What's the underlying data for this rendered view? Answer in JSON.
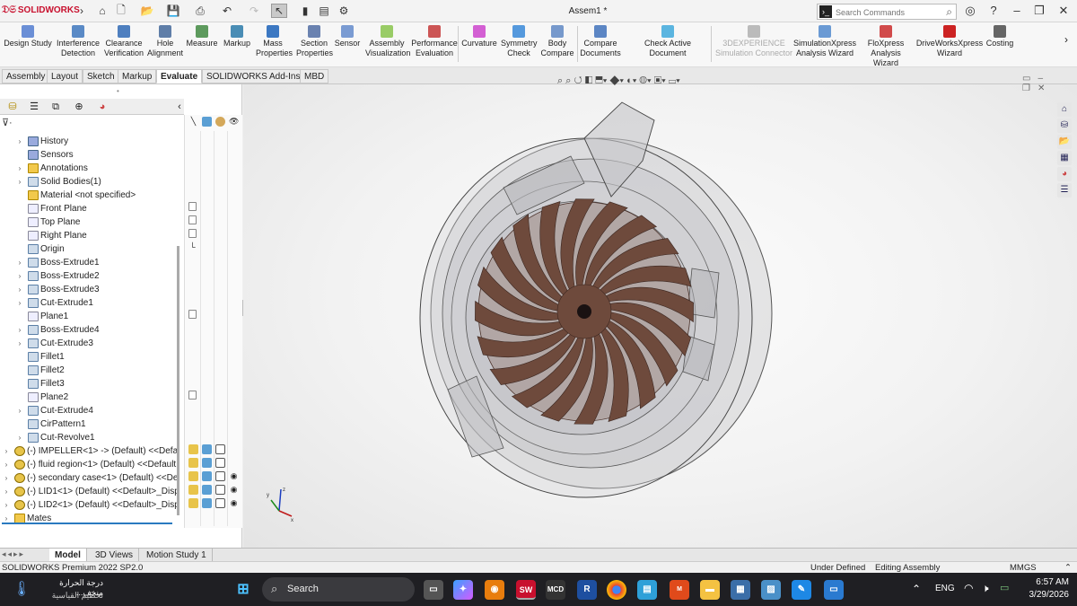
{
  "app": {
    "brand": "SOLIDWORKS",
    "doc_title": "Assem1 *"
  },
  "search": {
    "placeholder": "Search Commands"
  },
  "ribbon": [
    {
      "label": "Design Study",
      "color": "#6b8fd6"
    },
    {
      "label": "Interference Detection",
      "color": "#5a8ac6"
    },
    {
      "label": "Clearance Verification",
      "color": "#4e7fbf"
    },
    {
      "label": "Hole Alignment",
      "color": "#5f7ea8"
    },
    {
      "label": "Measure",
      "color": "#5d9a5d"
    },
    {
      "label": "Markup",
      "color": "#4a8db5"
    },
    {
      "label": "Mass Properties",
      "color": "#3c78c2"
    },
    {
      "label": "Section Properties",
      "color": "#6a82b0"
    },
    {
      "label": "Sensor",
      "color": "#7a9bd2"
    },
    {
      "label": "Assembly Visualization",
      "color": "#9c6"
    },
    {
      "label": "Performance Evaluation",
      "color": "#c55"
    },
    {
      "label": "Curvature",
      "color": "#d35fd3"
    },
    {
      "label": "Symmetry Check",
      "color": "#5599dd"
    },
    {
      "label": "Body Compare",
      "color": "#7799cc"
    },
    {
      "label": "Compare Documents",
      "color": "#5c86c4"
    },
    {
      "label": "Check Active Document",
      "color": "#5bb5e0"
    },
    {
      "label": "3DEXPERIENCE Simulation Connector",
      "color": "#bbbbbb",
      "disabled": true
    },
    {
      "label": "SimulationXpress Analysis Wizard",
      "color": "#6a9ad4"
    },
    {
      "label": "FloXpress Analysis Wizard",
      "color": "#d14a4a"
    },
    {
      "label": "DriveWorksXpress Wizard",
      "color": "#cc2222"
    },
    {
      "label": "Costing",
      "color": "#666666"
    }
  ],
  "command_tabs": [
    "Assembly",
    "Layout",
    "Sketch",
    "Markup",
    "Evaluate",
    "SOLIDWORKS Add-Ins",
    "MBD"
  ],
  "active_tab": "Evaluate",
  "tree": [
    {
      "label": "History",
      "icon": "history-icon",
      "expand": true
    },
    {
      "label": "Sensors",
      "icon": "sensor-icon"
    },
    {
      "label": "Annotations",
      "icon": "annotation-icon",
      "expand": true
    },
    {
      "label": "Solid Bodies(1)",
      "icon": "solid-bodies-icon",
      "expand": true
    },
    {
      "label": "Material <not specified>",
      "icon": "material-icon"
    },
    {
      "label": "Front Plane",
      "icon": "plane-icon"
    },
    {
      "label": "Top Plane",
      "icon": "plane-icon"
    },
    {
      "label": "Right Plane",
      "icon": "plane-icon"
    },
    {
      "label": "Origin",
      "icon": "origin-icon"
    },
    {
      "label": "Boss-Extrude1",
      "icon": "feature-icon",
      "expand": true
    },
    {
      "label": "Boss-Extrude2",
      "icon": "feature-icon",
      "expand": true
    },
    {
      "label": "Boss-Extrude3",
      "icon": "feature-icon",
      "expand": true
    },
    {
      "label": "Cut-Extrude1",
      "icon": "feature-icon",
      "expand": true
    },
    {
      "label": "Plane1",
      "icon": "plane-icon"
    },
    {
      "label": "Boss-Extrude4",
      "icon": "feature-icon",
      "expand": true
    },
    {
      "label": "Cut-Extrude3",
      "icon": "feature-icon",
      "expand": true
    },
    {
      "label": "Fillet1",
      "icon": "fillet-icon"
    },
    {
      "label": "Fillet2",
      "icon": "fillet-icon"
    },
    {
      "label": "Fillet3",
      "icon": "fillet-icon"
    },
    {
      "label": "Plane2",
      "icon": "plane-icon"
    },
    {
      "label": "Cut-Extrude4",
      "icon": "feature-icon",
      "expand": true
    },
    {
      "label": "CirPattern1",
      "icon": "pattern-icon"
    },
    {
      "label": "Cut-Revolve1",
      "icon": "feature-icon",
      "expand": true
    },
    {
      "label": "(-) IMPELLER<1> -> (Default) <<Default",
      "icon": "part-icon",
      "expand": true,
      "level": 0
    },
    {
      "label": "(-) fluid region<1> (Default) <<Default",
      "icon": "part-icon",
      "expand": true,
      "level": 0
    },
    {
      "label": "(-) secondary case<1> (Default) <<Def",
      "icon": "part-icon",
      "expand": true,
      "level": 0
    },
    {
      "label": "(-) LID1<1> (Default) <<Default>_Disp",
      "icon": "part-icon",
      "expand": true,
      "level": 0
    },
    {
      "label": "(-) LID2<1> (Default) <<Default>_Disp",
      "icon": "part-icon",
      "expand": true,
      "level": 0
    },
    {
      "label": "Mates",
      "icon": "mates-icon",
      "expand": true,
      "level": 0
    }
  ],
  "bottom_tabs": [
    "Model",
    "3D Views",
    "Motion Study 1"
  ],
  "status": {
    "version": "SOLIDWORKS Premium 2022 SP2.0",
    "state": "Under Defined",
    "mode": "Editing Assembly",
    "units": "MMGS"
  },
  "taskbar": {
    "weather_line1": "درجة الحرارة منخف...",
    "weather_line2": "تحطيم القياسية",
    "search": "Search",
    "lang": "ENG",
    "time": "6:57 AM",
    "date": "3/29/2026"
  },
  "colors": {
    "impeller": "#6e4a3c",
    "case": "#c9c9cc",
    "accent": "#c8102e"
  }
}
